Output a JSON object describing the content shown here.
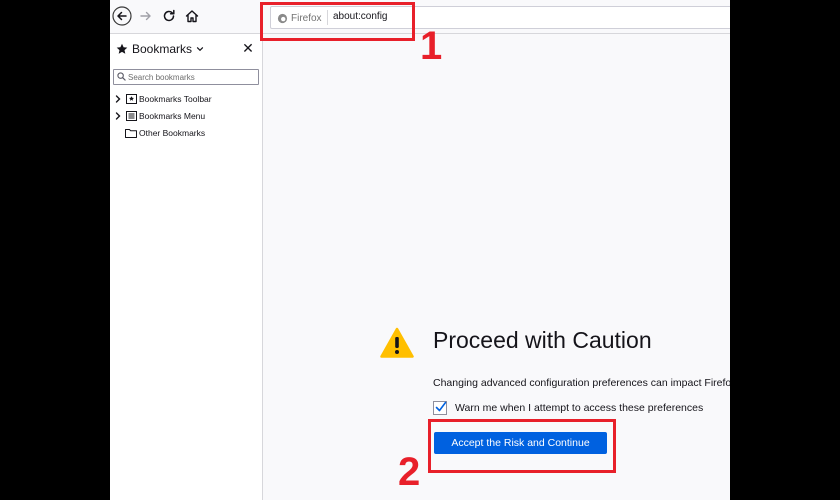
{
  "urlbar": {
    "identity_label": "Firefox",
    "url": "about:config"
  },
  "sidebar": {
    "title": "Bookmarks",
    "close_glyph": "✕",
    "search_placeholder": "Search bookmarks",
    "items": [
      {
        "label": "Bookmarks Toolbar",
        "expandable": true,
        "icon": "bookmarks-toolbar-icon"
      },
      {
        "label": "Bookmarks Menu",
        "expandable": true,
        "icon": "bookmarks-menu-icon"
      },
      {
        "label": "Other Bookmarks",
        "expandable": false,
        "icon": "folder-icon"
      }
    ]
  },
  "warning_page": {
    "title": "Proceed with Caution",
    "description": "Changing advanced configuration preferences can impact Firefox performance or security.",
    "checkbox_label": "Warn me when I attempt to access these preferences",
    "checkbox_checked": true,
    "accept_button": "Accept the Risk and Continue"
  },
  "annotations": {
    "step1": "1",
    "step2": "2",
    "highlight_color": "#e8202a"
  },
  "colors": {
    "accent": "#0061e0",
    "warning_yellow": "#ffbf00"
  }
}
